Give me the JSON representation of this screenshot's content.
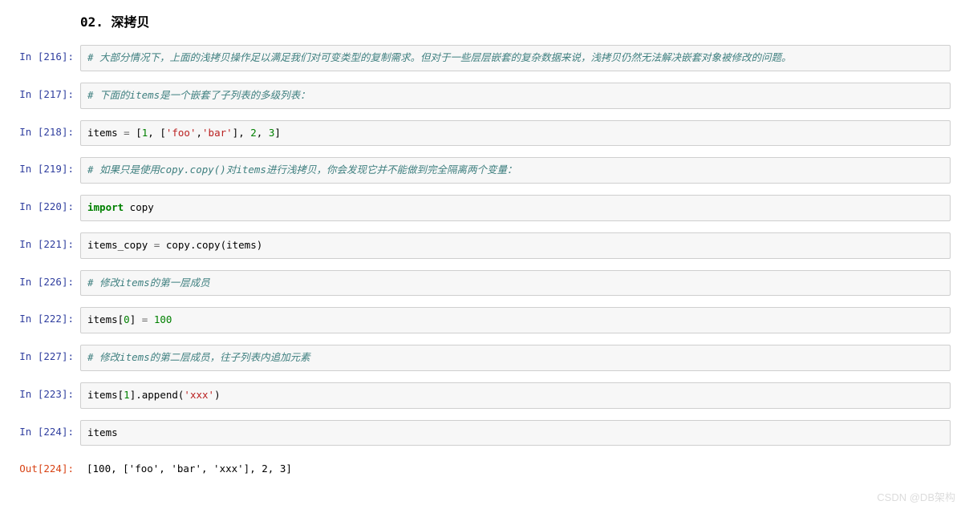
{
  "heading": "02. 深拷贝",
  "watermark": "CSDN @DB架构",
  "cells": [
    {
      "type": "in",
      "n": "216",
      "kind": "comment",
      "content": "# 大部分情况下，上面的浅拷贝操作足以满足我们对可变类型的复制需求。但对于一些层层嵌套的复杂数据来说，浅拷贝仍然无法解决嵌套对象被修改的问题。"
    },
    {
      "type": "in",
      "n": "217",
      "kind": "comment",
      "content": "# 下面的items是一个嵌套了子列表的多级列表："
    },
    {
      "type": "in",
      "n": "218",
      "kind": "code_218",
      "content": ""
    },
    {
      "type": "in",
      "n": "219",
      "kind": "comment",
      "content": "# 如果只是使用copy.copy()对items进行浅拷贝，你会发现它并不能做到完全隔离两个变量："
    },
    {
      "type": "in",
      "n": "220",
      "kind": "code_220",
      "content": ""
    },
    {
      "type": "in",
      "n": "221",
      "kind": "code_221",
      "content": ""
    },
    {
      "type": "in",
      "n": "226",
      "kind": "comment",
      "content": "# 修改items的第一层成员"
    },
    {
      "type": "in",
      "n": "222",
      "kind": "code_222",
      "content": ""
    },
    {
      "type": "in",
      "n": "227",
      "kind": "comment",
      "content": "# 修改items的第二层成员，往子列表内追加元素"
    },
    {
      "type": "in",
      "n": "223",
      "kind": "code_223",
      "content": ""
    },
    {
      "type": "in",
      "n": "224",
      "kind": "code_224",
      "content": ""
    },
    {
      "type": "out",
      "n": "224",
      "kind": "output",
      "content": "[100, ['foo', 'bar', 'xxx'], 2, 3]"
    }
  ],
  "code_tokens": {
    "c218": {
      "parts": [
        "items ",
        "=",
        " [",
        "1",
        ", [",
        "'foo'",
        ",",
        "'bar'",
        "], ",
        "2",
        ", ",
        "3",
        "]"
      ]
    },
    "c220": {
      "kw": "import",
      "rest": " copy"
    },
    "c221": {
      "parts": [
        "items_copy ",
        "=",
        " copy.copy(items)"
      ]
    },
    "c222": {
      "parts": [
        "items[",
        "0",
        "] ",
        "=",
        " ",
        "100"
      ]
    },
    "c223": {
      "parts": [
        "items[",
        "1",
        "].append(",
        "'xxx'",
        ")"
      ]
    },
    "c224": {
      "parts": [
        "items"
      ]
    }
  }
}
